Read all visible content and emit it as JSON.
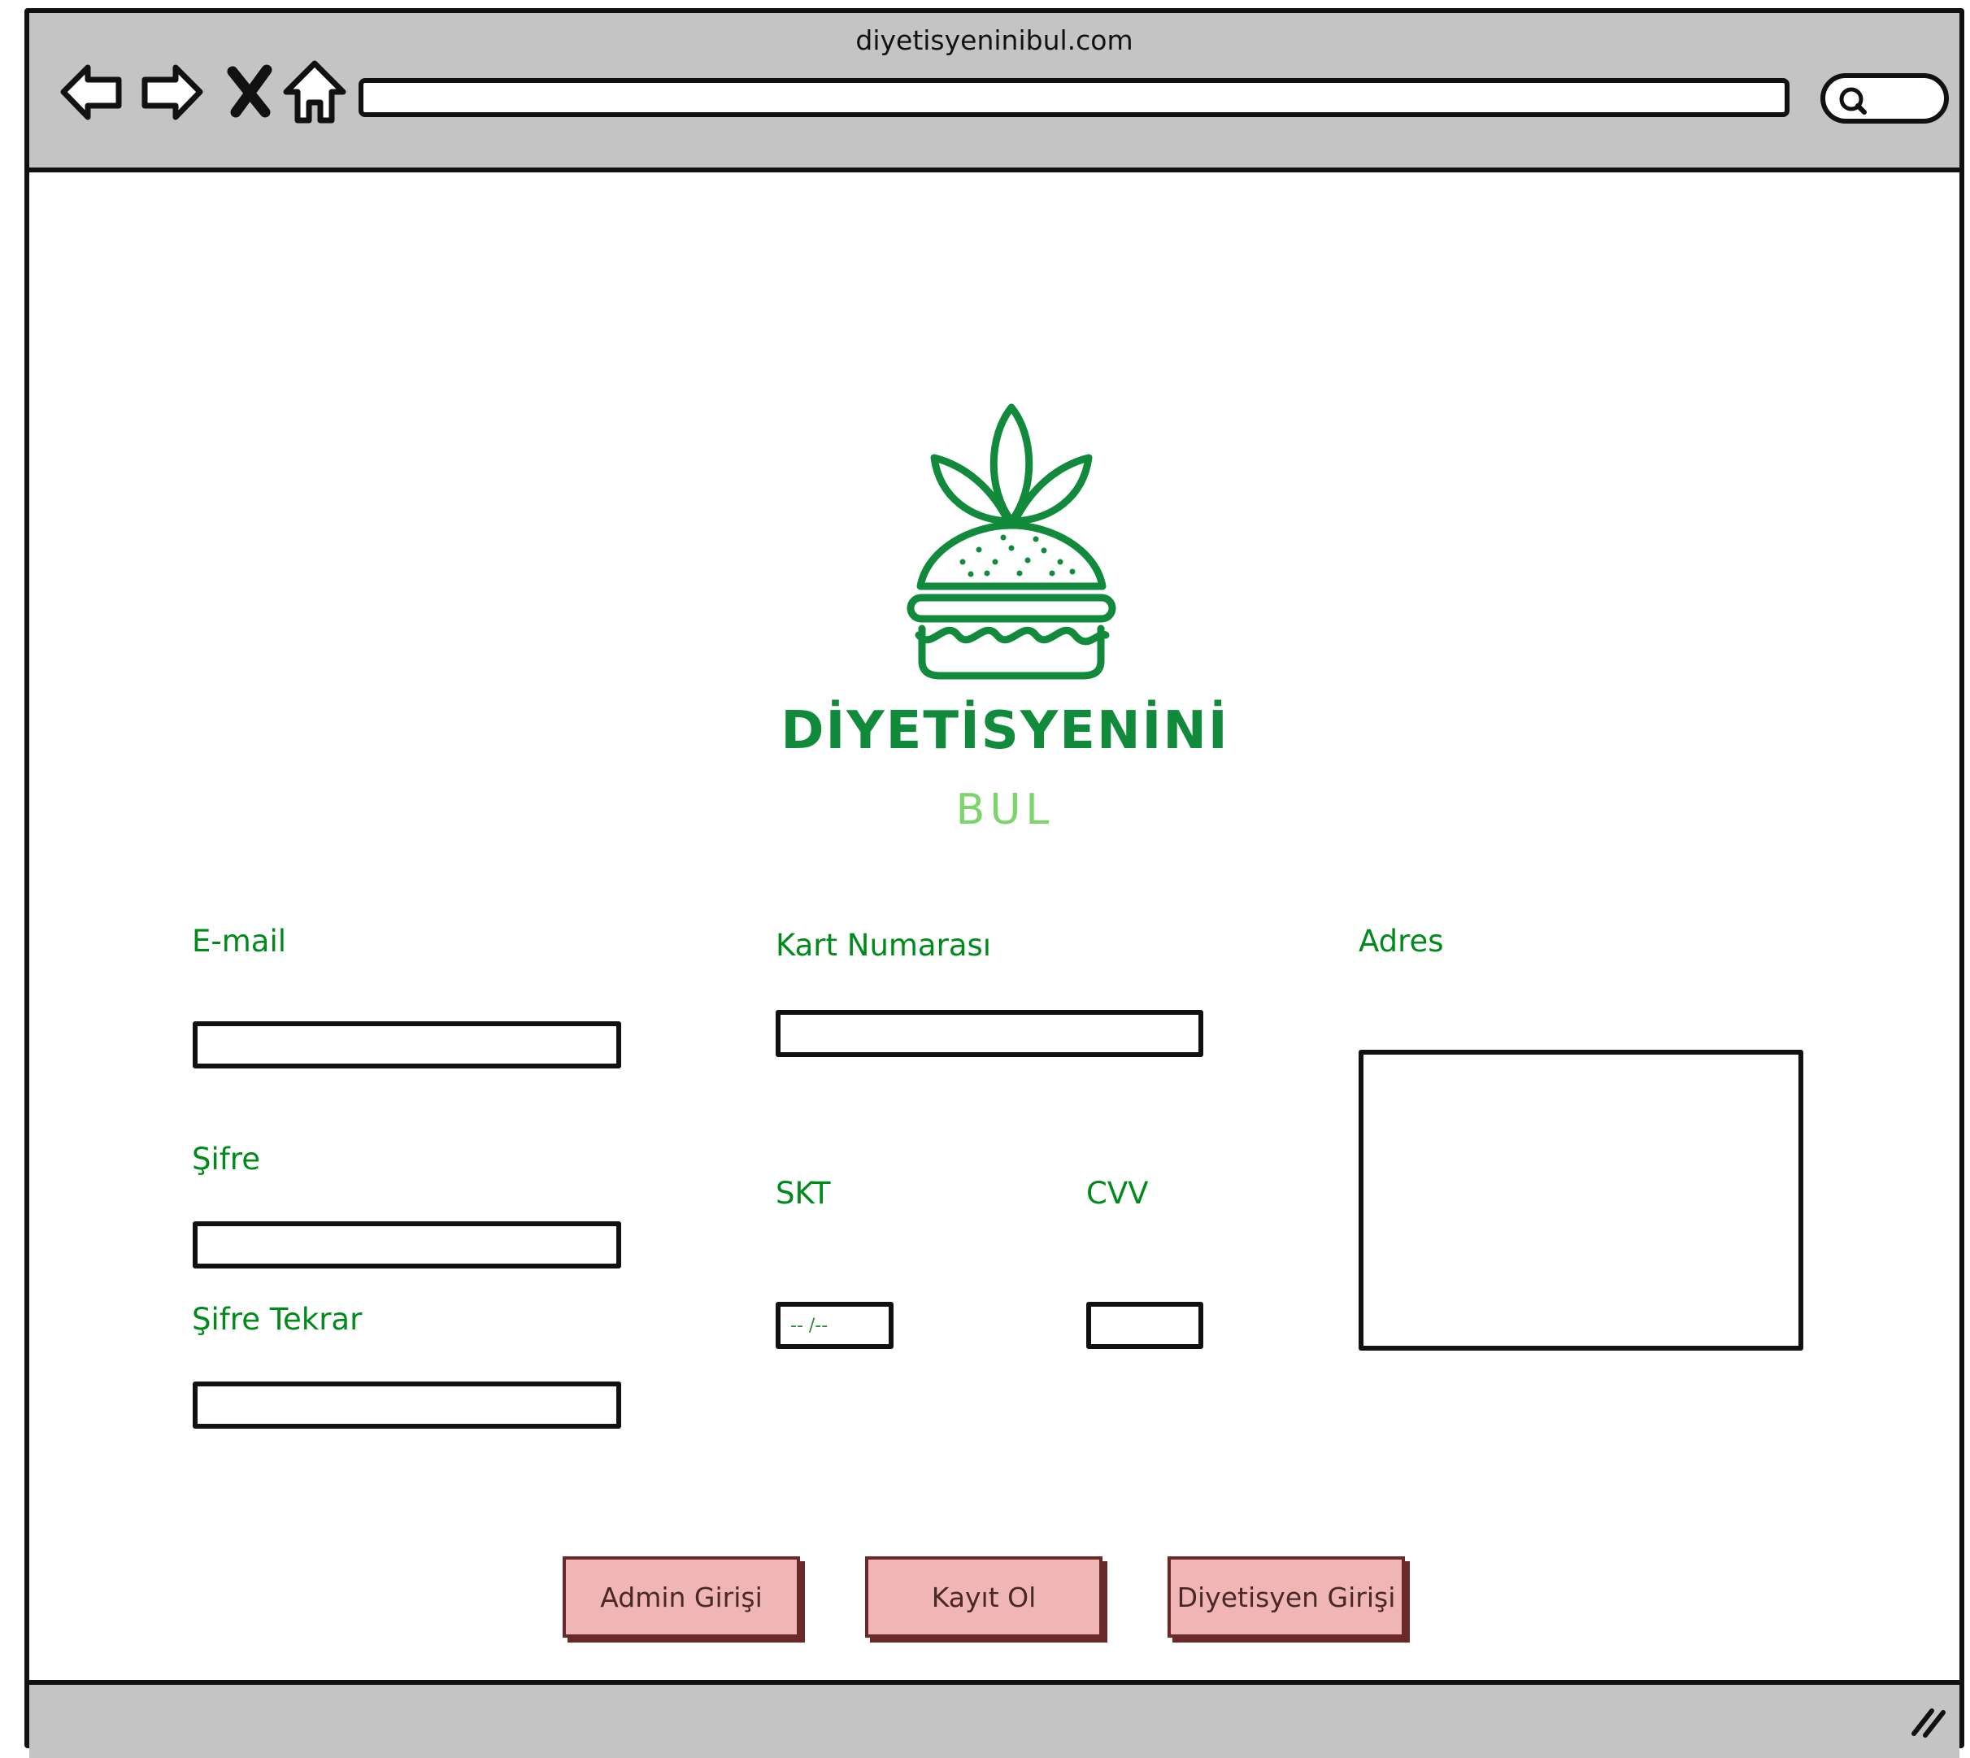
{
  "window": {
    "title": "diyetisyeninibul.com",
    "address_value": "",
    "search_value": ""
  },
  "nav_icons": [
    "back-arrow-icon",
    "forward-arrow-icon",
    "close-icon",
    "home-icon",
    "search-icon",
    "resize-grip-icon"
  ],
  "brand": {
    "name": "DİYETİSYENİNİ",
    "subtitle": "BUL",
    "logo_icon": "burger-leaf-logo",
    "primary_color": "#118a3c",
    "secondary_color": "#7bd56a"
  },
  "form": {
    "email": {
      "label": "E-mail",
      "value": ""
    },
    "password": {
      "label": "Şifre",
      "value": ""
    },
    "password_repeat": {
      "label": "Şifre Tekrar",
      "value": ""
    },
    "card_number": {
      "label": "Kart Numarası",
      "value": ""
    },
    "expiry": {
      "label": "SKT",
      "placeholder": "-- /--"
    },
    "cvv": {
      "label": "CVV",
      "value": ""
    },
    "address": {
      "label": "Adres",
      "value": ""
    },
    "label_color": "#008a1c"
  },
  "buttons": {
    "admin_login": "Admin Girişi",
    "register": "Kayıt Ol",
    "dietitian_login": "Diyetisyen Girişi",
    "fill_color": "#f0b5b5",
    "border_color": "#6b2a2a"
  }
}
